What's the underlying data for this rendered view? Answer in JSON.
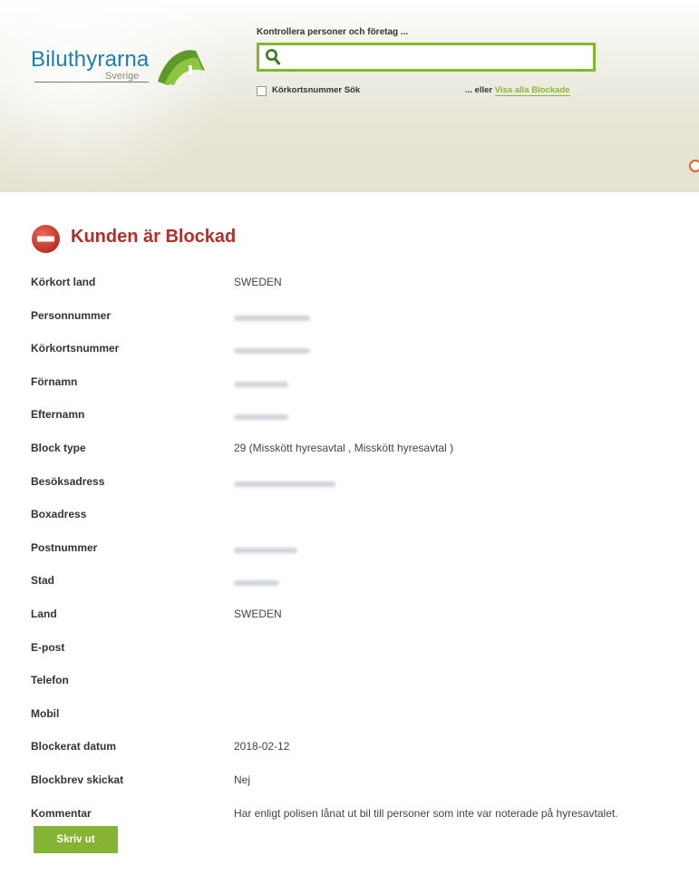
{
  "header": {
    "logo_text": "Biluthyrarna",
    "logo_sub": "Sverige",
    "search_label": "Kontrollera personer och företag ...",
    "search_value": "",
    "checkbox_label": "Körkortsnummer Sök",
    "eller_text": "... eller",
    "visa_link": "Visa alla Blockade"
  },
  "alert": {
    "title": "Kunden är Blockad",
    "color": "#b0302a"
  },
  "details": {
    "rows": [
      {
        "label": "Körkort land",
        "value": "SWEDEN",
        "redacted": false
      },
      {
        "label": "Personnummer",
        "value": "",
        "redacted": true
      },
      {
        "label": "Körkortsnummer",
        "value": "",
        "redacted": true
      },
      {
        "label": "Förnamn",
        "value": "",
        "redacted": true
      },
      {
        "label": "Efternamn",
        "value": "",
        "redacted": true
      },
      {
        "label": "Block type",
        "value": "29 (Misskött hyresavtal , Misskött hyresavtal )",
        "redacted": false
      },
      {
        "label": "Besöksadress",
        "value": "",
        "redacted": true
      },
      {
        "label": "Boxadress",
        "value": "",
        "redacted": false
      },
      {
        "label": "Postnummer",
        "value": "",
        "redacted": true
      },
      {
        "label": "Stad",
        "value": "",
        "redacted": true
      },
      {
        "label": "Land",
        "value": "SWEDEN",
        "redacted": false
      },
      {
        "label": "E-post",
        "value": "",
        "redacted": false
      },
      {
        "label": "Telefon",
        "value": "",
        "redacted": false
      },
      {
        "label": "Mobil",
        "value": "",
        "redacted": false
      },
      {
        "label": "Blockerat datum",
        "value": "2018-02-12",
        "redacted": false
      },
      {
        "label": "Blockbrev skickat",
        "value": "Nej",
        "redacted": false
      },
      {
        "label": "Kommentar",
        "value": "Har enligt polisen lånat ut bil till personer som inte var noterade på hyresavtalet.",
        "redacted": false
      }
    ]
  },
  "actions": {
    "print_label": "Skriv ut"
  },
  "colors": {
    "accent_green": "#86b333",
    "logo_blue": "#1b7fb0",
    "alert_red": "#b0302a"
  }
}
